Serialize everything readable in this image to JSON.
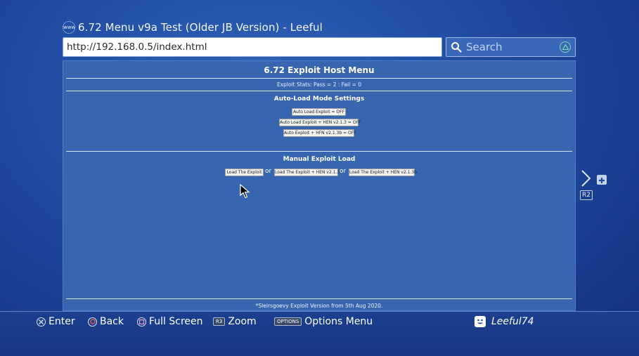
{
  "window": {
    "title": "6.72 Menu v9a Test (Older JB Version) - Leeful",
    "www_label": "www"
  },
  "address_bar": {
    "url": "http://192.168.0.5/index.html"
  },
  "search": {
    "placeholder": "Search"
  },
  "page": {
    "title": "6.72 Exploit Host Menu",
    "stats": "Exploit Stats:  Pass = 2   :   Fail = 0",
    "auto_load": {
      "heading": "Auto-Load Mode Settings",
      "buttons": [
        "Auto Load Exploit = OFF",
        "Auto Load Exploit + HEN v2.1.3 = OFF",
        "Auto Exploit + HFN v2.1.3b = OFF"
      ]
    },
    "manual": {
      "heading": "Manual Exploit Load",
      "buttons": [
        "Load The Exploit",
        "Load The Exploit + HEN v2.1.3",
        "Load The Exploit + HEN v2.1.3b"
      ],
      "separator": "or"
    },
    "footer": "*Sleirsgoevy Exploit Version from 5th Aug 2020."
  },
  "side": {
    "r2_label": "R2"
  },
  "bottom_bar": {
    "enter": "Enter",
    "back": "Back",
    "full_screen": "Full Screen",
    "r3_tag": "R3",
    "zoom": "Zoom",
    "options_tag": "OPTIONS",
    "options_menu": "Options Menu",
    "username": "Leeful74"
  },
  "colors": {
    "background": "#1f4aa0",
    "page_bg": "#3765b0",
    "triangle_green": "#7ed9a8",
    "circle_red": "#e05a5a"
  }
}
